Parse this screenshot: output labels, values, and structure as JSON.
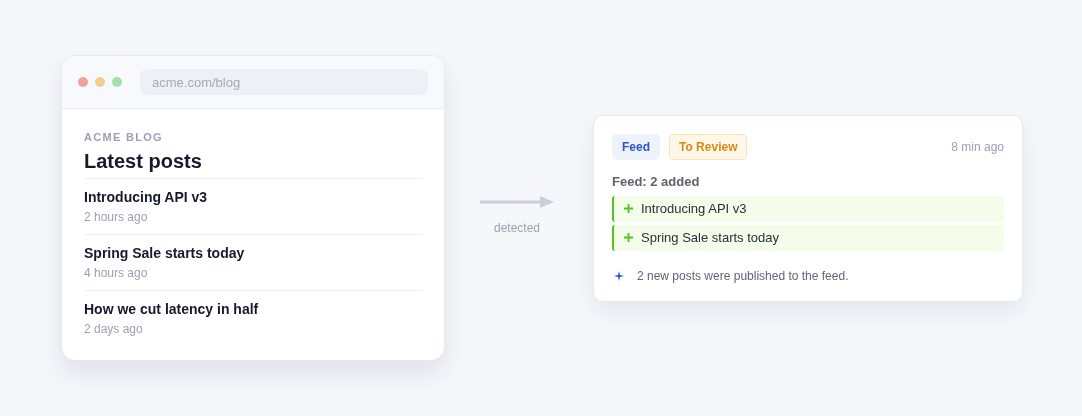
{
  "browser": {
    "url": "acme.com/blog",
    "site_name": "ACME BLOG",
    "heading": "Latest posts",
    "posts": [
      {
        "title": "Introducing API v3",
        "time": "2 hours ago"
      },
      {
        "title": "Spring Sale starts today",
        "time": "4 hours ago"
      },
      {
        "title": "How we cut latency in half",
        "time": "2 days ago"
      }
    ]
  },
  "connector": {
    "label": "detected"
  },
  "notification": {
    "tags": [
      {
        "label": "Feed",
        "kind": "source"
      },
      {
        "label": "To Review",
        "kind": "status"
      }
    ],
    "time": "8 min ago",
    "summary": "Feed: 2 added",
    "added": [
      {
        "title": "Introducing API v3"
      },
      {
        "title": "Spring Sale starts today"
      }
    ],
    "note": "2 new posts were published to the feed."
  }
}
